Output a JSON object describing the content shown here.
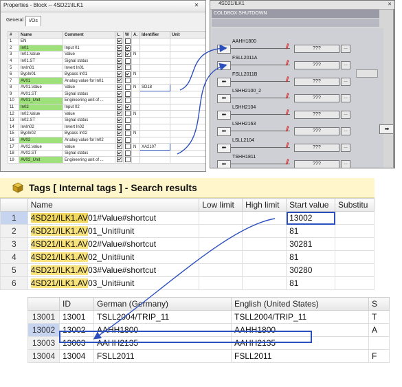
{
  "properties_window": {
    "title": "Properties - Block -- 4SD21\\ILK1",
    "tabs": [
      "General",
      "I/Os"
    ],
    "active_tab": "I/Os",
    "columns": [
      "#",
      "Name",
      "Comment",
      "I..",
      "W",
      "A.",
      "Identifier",
      "Unit"
    ],
    "rows": [
      {
        "num": "1",
        "name": "EN",
        "comment": "",
        "i": true,
        "w": false,
        "a": "",
        "identifier": "",
        "hl": false
      },
      {
        "num": "2",
        "name": "In01",
        "comment": "Input 01",
        "i": true,
        "w": true,
        "a": "",
        "identifier": "",
        "hl": true
      },
      {
        "num": "3",
        "name": "In01.Value",
        "comment": "Value",
        "i": true,
        "w": true,
        "a": "N",
        "identifier": "",
        "hl": false
      },
      {
        "num": "4",
        "name": "In01.ST",
        "comment": "Signal status",
        "i": true,
        "w": false,
        "a": "",
        "identifier": "",
        "hl": false
      },
      {
        "num": "5",
        "name": "InvIn01",
        "comment": "Invert In01",
        "i": true,
        "w": false,
        "a": "",
        "identifier": "",
        "hl": false
      },
      {
        "num": "6",
        "name": "BypIn01",
        "comment": "Bypass In01",
        "i": true,
        "w": true,
        "a": "N",
        "identifier": "",
        "hl": false
      },
      {
        "num": "7",
        "name": "AV01",
        "comment": "Analog value for In01",
        "i": true,
        "w": false,
        "a": "",
        "identifier": "",
        "hl": true
      },
      {
        "num": "8",
        "name": "AV01.Value",
        "comment": "Value",
        "i": true,
        "w": false,
        "a": "N",
        "identifier": "SD18",
        "hl": false
      },
      {
        "num": "9",
        "name": "AV01.ST",
        "comment": "Signal status",
        "i": true,
        "w": false,
        "a": "",
        "identifier": "",
        "hl": false
      },
      {
        "num": "10",
        "name": "AV01_Unit",
        "comment": "Engineering unit of ...",
        "i": true,
        "w": false,
        "a": "",
        "identifier": "",
        "hl": true
      },
      {
        "num": "11",
        "name": "In02",
        "comment": "Input 02",
        "i": true,
        "w": true,
        "a": "",
        "identifier": "",
        "hl": true
      },
      {
        "num": "12",
        "name": "In02.Value",
        "comment": "Value",
        "i": true,
        "w": false,
        "a": "N",
        "identifier": "",
        "hl": false
      },
      {
        "num": "13",
        "name": "In02.ST",
        "comment": "Signal status",
        "i": true,
        "w": false,
        "a": "",
        "identifier": "",
        "hl": false
      },
      {
        "num": "14",
        "name": "InvIn02",
        "comment": "Invert In02",
        "i": true,
        "w": false,
        "a": "",
        "identifier": "",
        "hl": false
      },
      {
        "num": "15",
        "name": "BypIn02",
        "comment": "Bypass In02",
        "i": true,
        "w": false,
        "a": "N",
        "identifier": "",
        "hl": false
      },
      {
        "num": "16",
        "name": "AV02",
        "comment": "Analog value for In02",
        "i": true,
        "w": false,
        "a": "",
        "identifier": "",
        "hl": true
      },
      {
        "num": "17",
        "name": "AV02.Value",
        "comment": "Value",
        "i": true,
        "w": false,
        "a": "N",
        "identifier": "XA2107",
        "hl": false
      },
      {
        "num": "18",
        "name": "AV02.ST",
        "comment": "Signal status",
        "i": true,
        "w": false,
        "a": "",
        "identifier": "",
        "hl": false
      },
      {
        "num": "19",
        "name": "AV02_Unit",
        "comment": "Engineering unit of ...",
        "i": true,
        "w": false,
        "a": "",
        "identifier": "",
        "hl": true
      }
    ]
  },
  "faceplate_window": {
    "title": "4SD21/ILK1",
    "header": "COLDBOX SHUTDOWN",
    "qbox_text": "???",
    "signals": [
      "AAHH1800",
      "FSLL2011A",
      "FSLL2011B",
      "LSHH2100_2",
      "LSHH2104",
      "LSHH2163",
      "LSLL2104",
      "TSHH1811"
    ]
  },
  "tags_window": {
    "title": "Tags [ Internal tags ] - Search results",
    "columns": [
      "",
      "Name",
      "Low limit",
      "High limit",
      "Start value",
      "Substitu"
    ],
    "rows": [
      {
        "rn": "1",
        "prefix": "4SD21/ILK1.AV",
        "suffix": "01#Value#shortcut",
        "start": "13002",
        "selected": true
      },
      {
        "rn": "2",
        "prefix": "4SD21/ILK1.AV",
        "suffix": "01_Unit#unit",
        "start": "81",
        "selected": false
      },
      {
        "rn": "3",
        "prefix": "4SD21/ILK1.AV",
        "suffix": "02#Value#shortcut",
        "start": "30281",
        "selected": false
      },
      {
        "rn": "4",
        "prefix": "4SD21/ILK1.AV",
        "suffix": "02_Unit#unit",
        "start": "81",
        "selected": false
      },
      {
        "rn": "5",
        "prefix": "4SD21/ILK1.AV",
        "suffix": "03#Value#shortcut",
        "start": "30280",
        "selected": false
      },
      {
        "rn": "6",
        "prefix": "4SD21/ILK1.AV",
        "suffix": "03_Unit#unit",
        "start": "81",
        "selected": false
      }
    ]
  },
  "text_window": {
    "columns": [
      "",
      "ID",
      "German (Germany)",
      "English (United States)",
      "S"
    ],
    "rows": [
      {
        "rn": "13001",
        "id": "13001",
        "de": "TSLL2004/TRIP_11",
        "en": "TSLL2004/TRIP_11",
        "extra": "T",
        "selected": false
      },
      {
        "rn": "13002",
        "id": "13002",
        "de": "AAHH1800",
        "en": "AAHH1800",
        "extra": "A",
        "selected": true
      },
      {
        "rn": "13003",
        "id": "13003",
        "de": "AAHH2135",
        "en": "AAHH2135",
        "extra": "",
        "selected": false
      },
      {
        "rn": "13004",
        "id": "13004",
        "de": "FSLL2011",
        "en": "FSLL2011",
        "extra": "F",
        "selected": false
      }
    ]
  },
  "colors": {
    "highlight_green": "#9ee07a",
    "annotation_blue": "#2b4fbd",
    "tag_highlight": "#f8e27c",
    "faceplate_header": "#9a9aa6"
  }
}
